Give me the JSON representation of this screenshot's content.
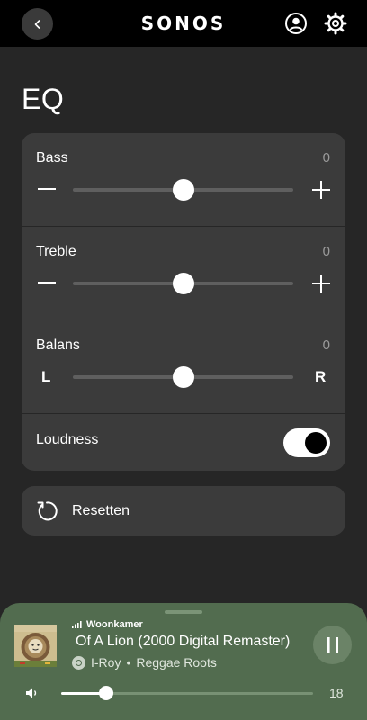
{
  "topbar": {
    "brand": "SONOS",
    "icons": [
      "chevron-left-icon",
      "account-icon",
      "gear-icon"
    ]
  },
  "page": {
    "title": "EQ"
  },
  "eq": {
    "rows": [
      {
        "label": "Bass",
        "value": "0",
        "left_control": "minus-icon",
        "right_control": "plus-icon",
        "level": 0.5
      },
      {
        "label": "Treble",
        "value": "0",
        "left_control": "minus-icon",
        "right_control": "plus-icon",
        "level": 0.5
      },
      {
        "label": "Balans",
        "value": "0",
        "left_text": "L",
        "right_text": "R",
        "level": 0.5
      }
    ],
    "loudness": {
      "label": "Loudness",
      "on": true
    }
  },
  "reset": {
    "label": "Resetten",
    "icon": "reset-icon"
  },
  "now_playing": {
    "room": "Woonkamer",
    "track_title": "Of A Lion (2000 Digital Remaster)",
    "artist": "I-Roy",
    "album": "Reggae Roots",
    "separator": "•",
    "volume": "18",
    "volume_level": 0.18,
    "accent_color": "#526c4f"
  }
}
